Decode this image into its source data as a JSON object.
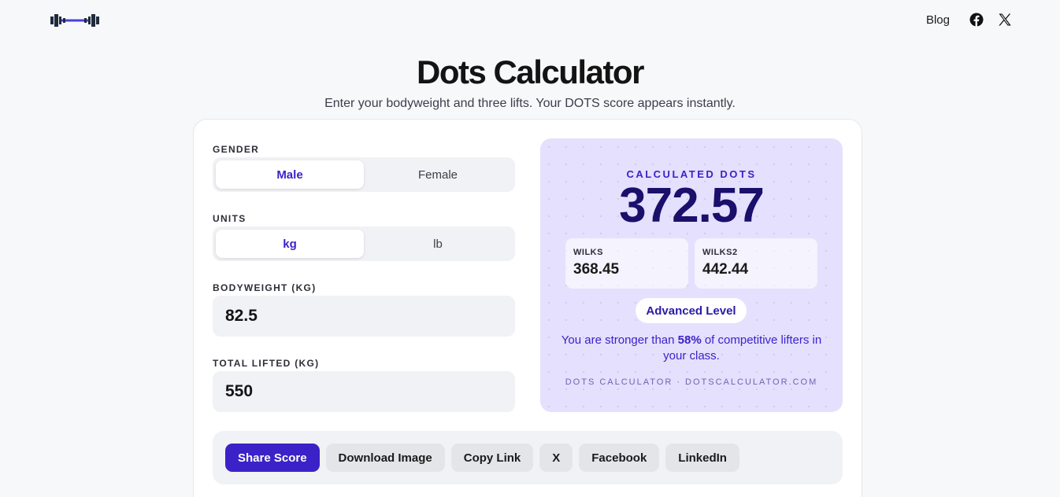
{
  "header": {
    "logo_icon": "barbell-icon",
    "blog_label": "Blog",
    "social_icons": [
      "facebook-icon",
      "x-icon"
    ]
  },
  "page": {
    "title": "Dots Calculator",
    "subtitle": "Enter your bodyweight and three lifts. Your DOTS score appears instantly."
  },
  "form": {
    "gender_label": "GENDER",
    "gender_options": [
      "Male",
      "Female"
    ],
    "gender_selected": "Male",
    "units_label": "UNITS",
    "units_options": [
      "kg",
      "lb"
    ],
    "units_selected": "kg",
    "bodyweight_label": "BODYWEIGHT (KG)",
    "bodyweight_value": "82.5",
    "total_label": "TOTAL LIFTED (KG)",
    "total_value": "550"
  },
  "result": {
    "label": "CALCULATED DOTS",
    "value": "372.57",
    "wilks_label": "WILKS",
    "wilks_value": "368.45",
    "wilks2_label": "WILKS2",
    "wilks2_value": "442.44",
    "level": "Advanced Level",
    "stronger_prefix": "You are stronger than ",
    "stronger_percent": "58%",
    "stronger_suffix": " of competitive lifters in your class.",
    "footer": "DOTS CALCULATOR · DOTSCALCULATOR.COM"
  },
  "share": {
    "share_score": "Share Score",
    "download_image": "Download Image",
    "copy_link": "Copy Link",
    "x": "X",
    "facebook": "Facebook",
    "linkedin": "LinkedIn"
  },
  "colors": {
    "accent": "#3b22c8",
    "result_bg": "#e4e0fd",
    "page_bg": "#f7f8fa"
  }
}
